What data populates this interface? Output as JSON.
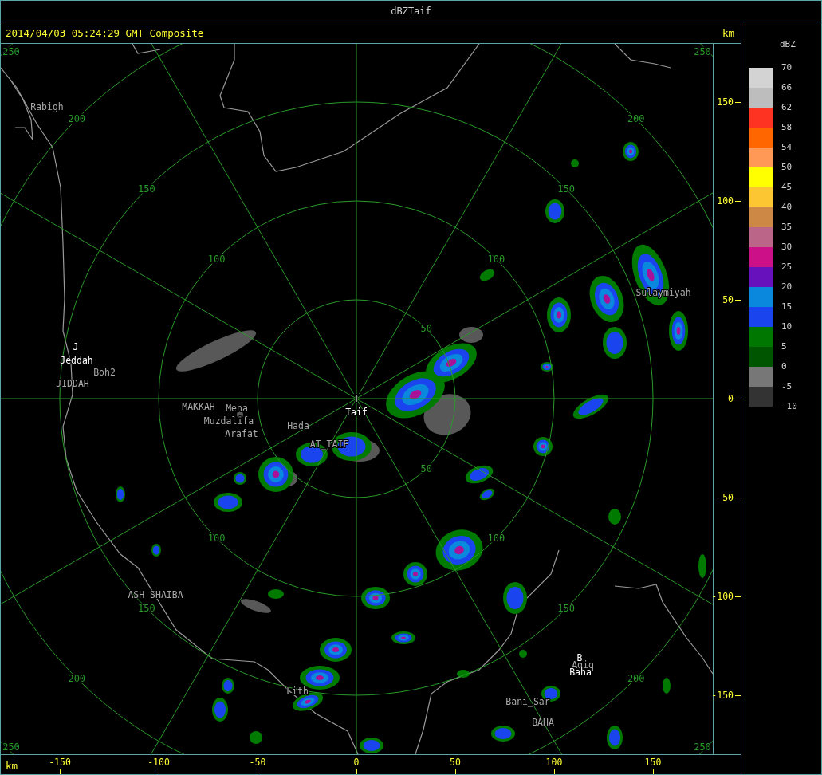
{
  "window": {
    "title": "dBZTaif"
  },
  "caption": "2014/04/03 05:24:29 GMT Composite",
  "map": {
    "range_labels": [
      "250",
      "250",
      "200",
      "200",
      "150",
      "150",
      "100",
      "100",
      "50",
      "50",
      "100",
      "100",
      "150",
      "150",
      "200",
      "200",
      "250",
      "250"
    ],
    "places": [
      {
        "name": "Rabigh",
        "kind": "place"
      },
      {
        "name": "J",
        "kind": "site"
      },
      {
        "name": "Jeddah",
        "kind": "site"
      },
      {
        "name": "Boh2",
        "kind": "place"
      },
      {
        "name": "JIDDAH",
        "kind": "place"
      },
      {
        "name": "MAKKAH",
        "kind": "place"
      },
      {
        "name": "Mena",
        "kind": "place"
      },
      {
        "name": "Muzdalifa",
        "kind": "place"
      },
      {
        "name": "Arafat",
        "kind": "place"
      },
      {
        "name": "Hada",
        "kind": "place"
      },
      {
        "name": "T",
        "kind": "site"
      },
      {
        "name": "Taif",
        "kind": "site"
      },
      {
        "name": "AT_TAIF",
        "kind": "place"
      },
      {
        "name": "Sulaymiyah",
        "kind": "place"
      },
      {
        "name": "ASH_SHAIBA",
        "kind": "place"
      },
      {
        "name": "Lith",
        "kind": "place"
      },
      {
        "name": "B",
        "kind": "site"
      },
      {
        "name": "Aqiq",
        "kind": "place"
      },
      {
        "name": "Baha",
        "kind": "site"
      },
      {
        "name": "Bani_Sar",
        "kind": "place"
      },
      {
        "name": "BAHA",
        "kind": "place"
      }
    ]
  },
  "y_axis": {
    "unit": "km",
    "ticks": [
      "150",
      "100",
      "50",
      "0",
      "-50",
      "-100",
      "-150"
    ]
  },
  "x_axis": {
    "unit": "km",
    "ticks": [
      "-150",
      "-100",
      "-50",
      "0",
      "50",
      "100",
      "150"
    ]
  },
  "legend": {
    "unit": "dBZ",
    "bins": [
      {
        "color": "#d3d3d3"
      },
      {
        "color": "#bdbdbd"
      },
      {
        "color": "#ff3322"
      },
      {
        "color": "#ff6600"
      },
      {
        "color": "#ff9955"
      },
      {
        "color": "#ffff00"
      },
      {
        "color": "#fcc633"
      },
      {
        "color": "#cc8844"
      },
      {
        "color": "#bb6688"
      },
      {
        "color": "#cc1188"
      },
      {
        "color": "#6611bb"
      },
      {
        "color": "#0a88dd"
      },
      {
        "color": "#1a44ee"
      },
      {
        "color": "#007700"
      },
      {
        "color": "#005500"
      },
      {
        "color": "#777777"
      },
      {
        "color": "#333333"
      }
    ],
    "ticks": [
      "70",
      "66",
      "62",
      "58",
      "54",
      "50",
      "45",
      "40",
      "35",
      "30",
      "25",
      "20",
      "15",
      "10",
      "5",
      "0",
      "-5",
      "-10"
    ]
  }
}
